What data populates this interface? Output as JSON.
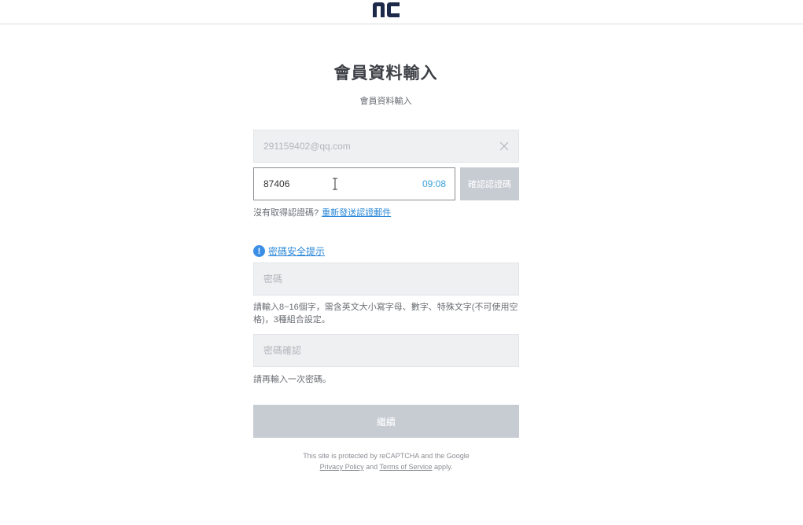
{
  "header": {
    "logo_icon": "nc-logo-icon"
  },
  "page": {
    "title": "會員資料輸入",
    "subtitle": "會員資料輸入"
  },
  "form": {
    "email_value": "291159402@qq.com",
    "clear_icon": "close-icon",
    "code_value": "87406",
    "timer": "09:08",
    "verify_button": "確認認證碼",
    "resend_prompt": "沒有取得認證碼?",
    "resend_link": "重新發送認證郵件",
    "password_tip_icon": "info-icon",
    "password_tip": "密碼安全提示",
    "password_placeholder": "密碼",
    "password_hint": "請輸入8~16個字，需含英文大小寫字母、數字、特殊文字(不可使用空格)，3種組合設定。",
    "confirm_placeholder": "密碼確認",
    "confirm_hint": "請再輸入一次密碼。",
    "continue_button": "繼續"
  },
  "recaptcha": {
    "line1": "This site is protected by reCAPTCHA and the Google",
    "privacy": "Privacy Policy",
    "and": "and",
    "terms": "Terms of Service",
    "apply": "apply."
  },
  "colors": {
    "accent": "#2b88d8",
    "timer": "#3aa0d8",
    "button_disabled": "#c7ccd3",
    "field_bg": "#eef0f2"
  }
}
